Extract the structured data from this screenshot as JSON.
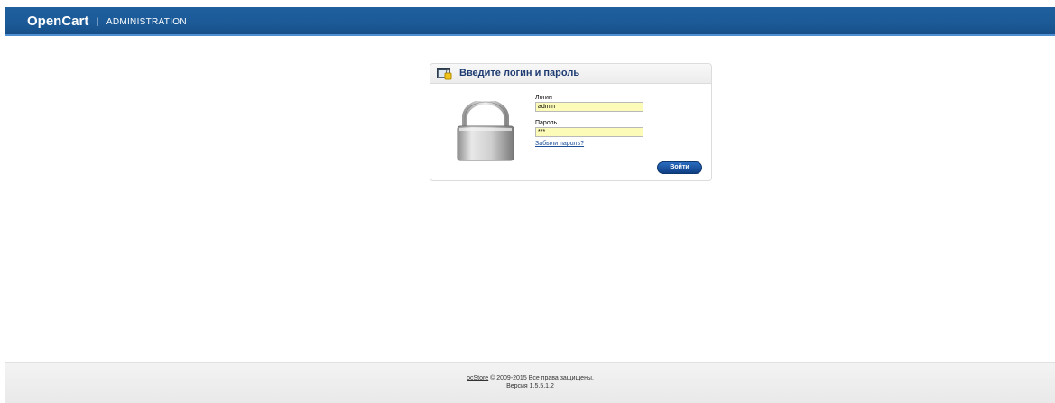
{
  "header": {
    "brand": "OpenCart",
    "separator": "|",
    "section": "ADMINISTRATION"
  },
  "login_box": {
    "title": "Введите логин и пароль",
    "username_label": "Логин",
    "username_value": "admin",
    "password_label": "Пароль",
    "password_value": "***",
    "forgot_link": "Забыли пароль?",
    "submit_label": "Войти"
  },
  "footer": {
    "link": "ocStore",
    "copyright": "© 2009-2015 Все права защищены.",
    "version": "Версия 1.5.5.1.2"
  },
  "colors": {
    "header_bg": "#1b5a97",
    "input_bg": "#fcfcb8",
    "title_color": "#1e3c72",
    "button_bg": "#1b56a5"
  },
  "icons": [
    "window-lock-icon",
    "padlock-icon"
  ]
}
